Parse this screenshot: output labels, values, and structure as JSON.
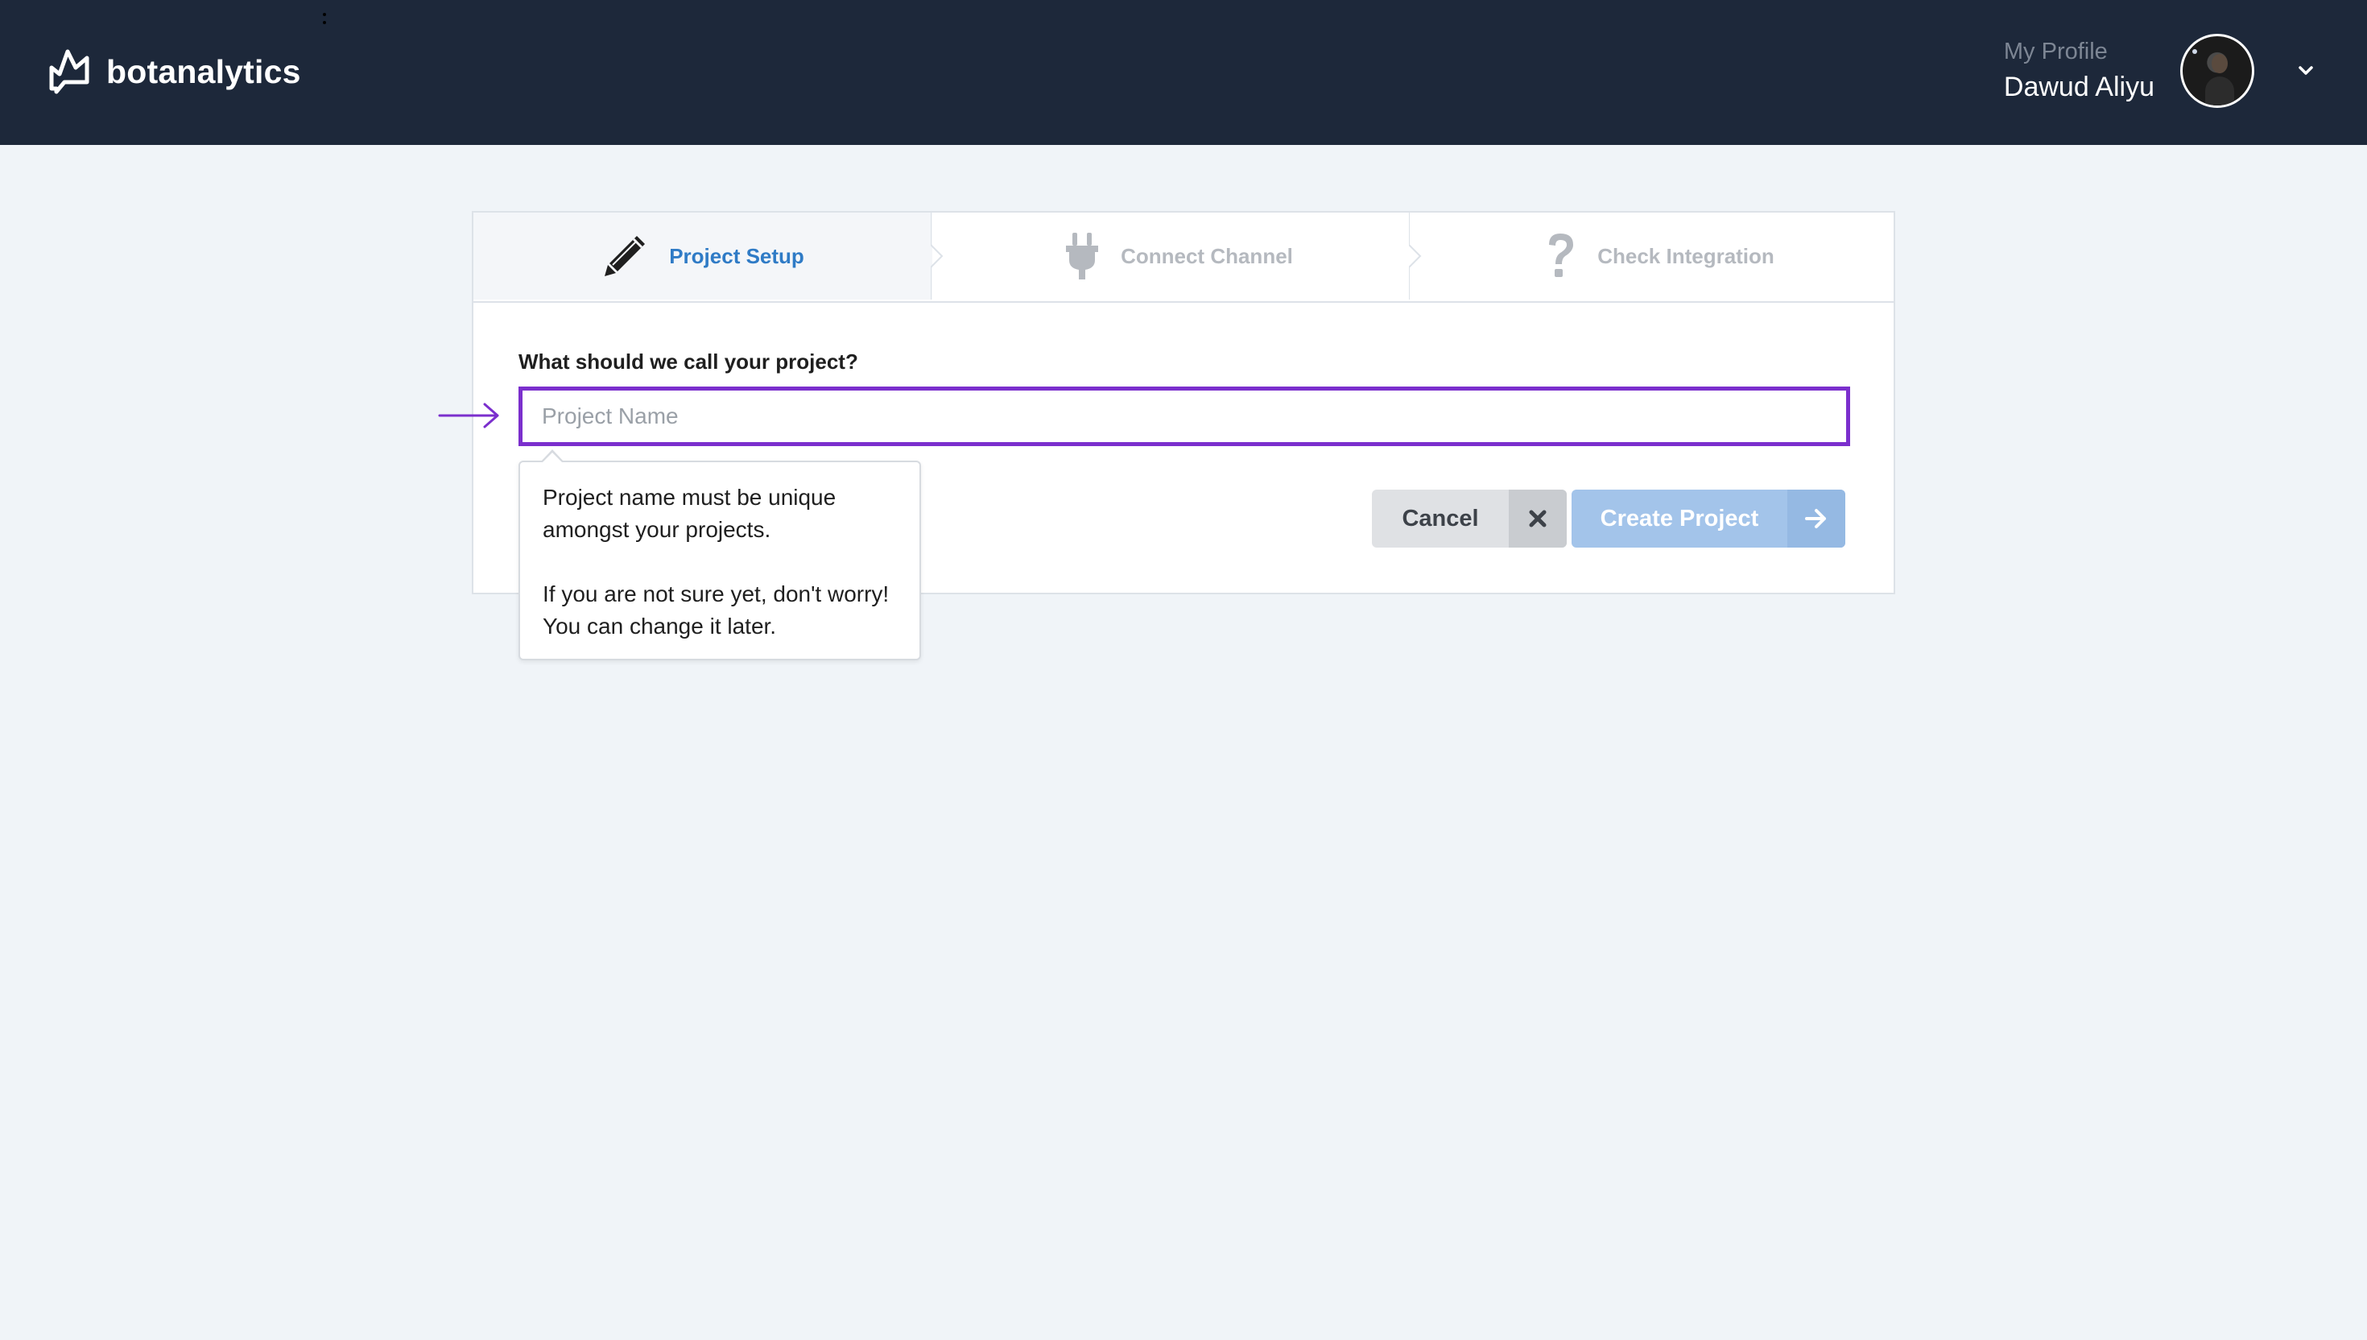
{
  "header": {
    "brand": "botanalytics",
    "profile_caption": "My Profile",
    "profile_name": "Dawud Aliyu"
  },
  "steps": [
    {
      "label": "Project Setup",
      "icon": "pencil-icon",
      "active": true
    },
    {
      "label": "Connect Channel",
      "icon": "plug-icon",
      "active": false
    },
    {
      "label": "Check Integration",
      "icon": "question-icon",
      "active": false
    }
  ],
  "form": {
    "question": "What should we call your project?",
    "input_value": "",
    "input_placeholder": "Project Name"
  },
  "tooltip": {
    "line1": "Project name must be unique amongst your projects.",
    "line2": "If you are not sure yet, don't worry! You can change it later."
  },
  "buttons": {
    "cancel": "Cancel",
    "create": "Create Project"
  },
  "colors": {
    "topbar": "#1d283a",
    "accent_active_step": "#2f7bc6",
    "input_focus": "#7b2fcd",
    "create_button": "#a3c4ea",
    "background": "#f0f4f8"
  }
}
